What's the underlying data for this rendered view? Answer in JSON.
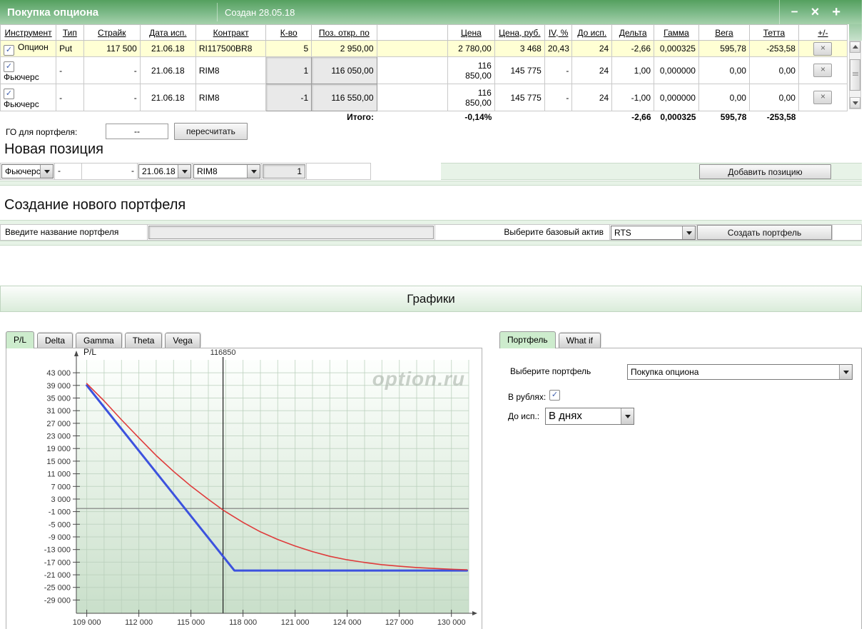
{
  "ui": {
    "check_glyph": "✓",
    "delete_glyph": "×"
  },
  "window": {
    "title": "Покупка опциона",
    "created": "Создан 28.05.18",
    "minimize_glyph": "−",
    "close_glyph": "×",
    "add_glyph": "+"
  },
  "positions_table": {
    "columns": [
      "Инструмент",
      "Тип",
      "Страйк",
      "Дата исп.",
      "Контракт",
      "К-во",
      "Поз. откр. по",
      "",
      "Цена",
      "Цена, руб.",
      "IV, %",
      "До исп.",
      "Дельта",
      "Гамма",
      "Вега",
      "Тетта",
      "+/-"
    ],
    "rows": [
      {
        "checked": true,
        "inst": "Опцион",
        "type": "Put",
        "strike": "117 500",
        "date": "21.06.18",
        "contract": "RI117500BR8",
        "qty": "5",
        "open": "2 950,00",
        "price": "2 780,00",
        "rub": "3 468",
        "iv": "20,43",
        "days": "24",
        "delta": "-2,66",
        "gamma": "0,000325",
        "vega": "595,78",
        "theta": "-253,58"
      },
      {
        "checked": true,
        "inst": "Фьючерс",
        "type": "-",
        "strike": "-",
        "date": "21.06.18",
        "contract": "RIM8",
        "qty": "1",
        "open": "116 050,00",
        "price": "116 850,00",
        "rub": "145 775",
        "iv": "-",
        "days": "24",
        "delta": "1,00",
        "gamma": "0,000000",
        "vega": "0,00",
        "theta": "0,00"
      },
      {
        "checked": true,
        "inst": "Фьючерс",
        "type": "-",
        "strike": "-",
        "date": "21.06.18",
        "contract": "RIM8",
        "qty": "-1",
        "open": "116 550,00",
        "price": "116 850,00",
        "rub": "145 775",
        "iv": "-",
        "days": "24",
        "delta": "-1,00",
        "gamma": "0,000000",
        "vega": "0,00",
        "theta": "0,00"
      }
    ],
    "totals": {
      "label": "Итого:",
      "price_pct": "-0,14%",
      "delta": "-2,66",
      "gamma": "0,000325",
      "vega": "595,78",
      "theta": "-253,58"
    }
  },
  "margin": {
    "label": "ГО для портфеля:",
    "value": "--",
    "recalc_button": "пересчитать"
  },
  "new_position": {
    "heading": "Новая позиция",
    "instrument": "Фьючерс",
    "type": "-",
    "strike": "-",
    "date": "21.06.18",
    "contract": "RIM8",
    "qty": "1",
    "add_button": "Добавить позицию"
  },
  "new_portfolio": {
    "heading": "Создание нового портфеля",
    "name_label": "Введите название портфеля",
    "name_value": "",
    "asset_label": "Выберите базовый актив",
    "asset_value": "RTS",
    "create_button": "Создать портфель"
  },
  "charts_section": {
    "heading": "Графики"
  },
  "chart_tabs": {
    "items": [
      "P/L",
      "Delta",
      "Gamma",
      "Theta",
      "Vega"
    ],
    "active": "P/L"
  },
  "right_panel": {
    "tabs": [
      "Портфель",
      "What if"
    ],
    "active_tab": "Портфель",
    "portfolio_label": "Выберите портфель",
    "portfolio_value": "Покупка опциона",
    "rub_label": "В рублях:",
    "rub_checked": true,
    "days_label": "До исп.:",
    "days_value": "В днях"
  },
  "chart_data": {
    "type": "line",
    "axis_title": "P/L",
    "watermark": "option.ru",
    "xlim": [
      108400,
      131000
    ],
    "ylim": [
      -33200,
      47100
    ],
    "x_ticks": [
      109000,
      112000,
      115000,
      118000,
      121000,
      124000,
      127000,
      130000
    ],
    "x_tick_labels": [
      "109 000",
      "112 000",
      "115 000",
      "118 000",
      "121 000",
      "124 000",
      "127 000",
      "130 000"
    ],
    "y_ticks": [
      43000,
      39000,
      35000,
      31000,
      27000,
      23000,
      19000,
      15000,
      11000,
      7000,
      3000,
      -1000,
      -5000,
      -9000,
      -13000,
      -17000,
      -21000,
      -25000,
      -29000
    ],
    "y_tick_labels": [
      "43 000",
      "39 000",
      "35 000",
      "31 000",
      "27 000",
      "23 000",
      "19 000",
      "15 000",
      "11 000",
      "7 000",
      "3 000",
      "-1 000",
      "-5 000",
      "-9 000",
      "-13 000",
      "-17 000",
      "-21 000",
      "-25 000",
      "-29 000"
    ],
    "grid_x_step": 1000,
    "zero_line": 0,
    "vline": {
      "x": 116850,
      "label": "116850"
    },
    "series": [
      {
        "name": "pl-expiration",
        "color": "#3c52de",
        "width": 3,
        "points": [
          [
            109000,
            39000
          ],
          [
            117500,
            -19650
          ],
          [
            130900,
            -19650
          ]
        ]
      },
      {
        "name": "pl-current",
        "color": "#df3b3b",
        "width": 1.6,
        "points": [
          [
            109000,
            39600
          ],
          [
            110000,
            34100
          ],
          [
            111000,
            28100
          ],
          [
            112000,
            22400
          ],
          [
            113000,
            16800
          ],
          [
            114000,
            11750
          ],
          [
            115000,
            7100
          ],
          [
            116000,
            2900
          ],
          [
            116850,
            -500
          ],
          [
            118000,
            -4400
          ],
          [
            119000,
            -7400
          ],
          [
            120000,
            -9800
          ],
          [
            121000,
            -11900
          ],
          [
            122000,
            -13650
          ],
          [
            123000,
            -15150
          ],
          [
            124000,
            -16250
          ],
          [
            125000,
            -17100
          ],
          [
            126000,
            -17800
          ],
          [
            127000,
            -18300
          ],
          [
            128000,
            -18700
          ],
          [
            129000,
            -19000
          ],
          [
            130000,
            -19250
          ],
          [
            130900,
            -19400
          ]
        ]
      }
    ]
  }
}
